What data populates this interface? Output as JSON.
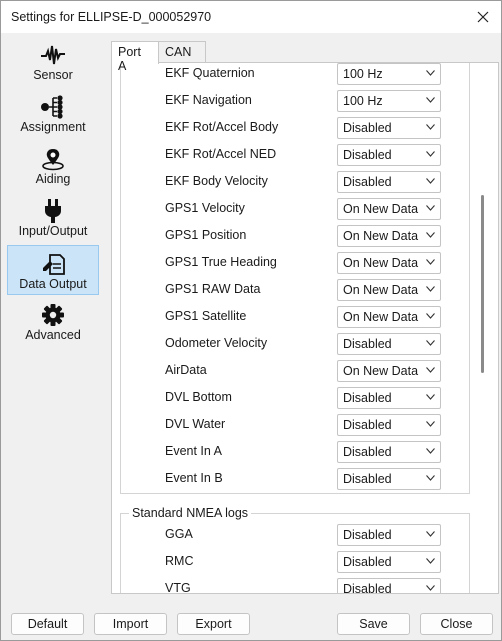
{
  "window": {
    "title": "Settings for ELLIPSE-D_000052970"
  },
  "sidebar": {
    "items": [
      {
        "label": "Sensor",
        "icon": "waveform-icon"
      },
      {
        "label": "Assignment",
        "icon": "hierarchy-icon"
      },
      {
        "label": "Aiding",
        "icon": "location-pin-icon"
      },
      {
        "label": "Input/Output",
        "icon": "plug-icon"
      },
      {
        "label": "Data Output",
        "icon": "document-edit-icon",
        "active": true
      },
      {
        "label": "Advanced",
        "icon": "gear-icon"
      }
    ]
  },
  "tabs": [
    {
      "label": "Port A",
      "active": true
    },
    {
      "label": "CAN"
    }
  ],
  "logs": [
    {
      "label": "EKF Quaternion",
      "value": "100 Hz"
    },
    {
      "label": "EKF Navigation",
      "value": "100 Hz"
    },
    {
      "label": "EKF Rot/Accel Body",
      "value": "Disabled"
    },
    {
      "label": "EKF Rot/Accel NED",
      "value": "Disabled"
    },
    {
      "label": "EKF Body Velocity",
      "value": "Disabled"
    },
    {
      "label": "GPS1 Velocity",
      "value": "On New Data"
    },
    {
      "label": "GPS1 Position",
      "value": "On New Data"
    },
    {
      "label": "GPS1 True Heading",
      "value": "On New Data"
    },
    {
      "label": "GPS1 RAW Data",
      "value": "On New Data"
    },
    {
      "label": "GPS1 Satellite",
      "value": "On New Data"
    },
    {
      "label": "Odometer Velocity",
      "value": "Disabled"
    },
    {
      "label": "AirData",
      "value": "On New Data"
    },
    {
      "label": "DVL Bottom",
      "value": "Disabled"
    },
    {
      "label": "DVL Water",
      "value": "Disabled"
    },
    {
      "label": "Event In A",
      "value": "Disabled"
    },
    {
      "label": "Event In B",
      "value": "Disabled"
    }
  ],
  "nmea": {
    "title": "Standard NMEA logs",
    "logs": [
      {
        "label": "GGA",
        "value": "Disabled"
      },
      {
        "label": "RMC",
        "value": "Disabled"
      },
      {
        "label": "VTG",
        "value": "Disabled"
      }
    ]
  },
  "buttons": {
    "default": "Default",
    "import": "Import",
    "export": "Export",
    "save": "Save",
    "close": "Close"
  },
  "colors": {
    "active_nav_bg": "#cce4f7",
    "active_nav_border": "#99c9ef"
  }
}
